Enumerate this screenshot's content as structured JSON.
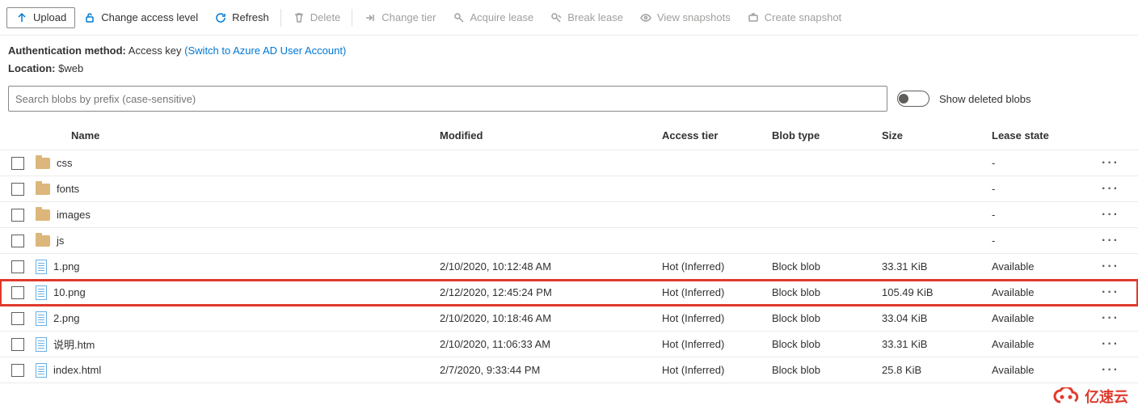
{
  "toolbar": {
    "upload": "Upload",
    "access_level": "Change access level",
    "refresh": "Refresh",
    "delete": "Delete",
    "change_tier": "Change tier",
    "acquire_lease": "Acquire lease",
    "break_lease": "Break lease",
    "view_snapshots": "View snapshots",
    "create_snapshot": "Create snapshot"
  },
  "info": {
    "auth_label": "Authentication method:",
    "auth_value": "Access key",
    "auth_link": "(Switch to Azure AD User Account)",
    "location_label": "Location:",
    "location_value": "$web"
  },
  "search": {
    "placeholder": "Search blobs by prefix (case-sensitive)"
  },
  "toggle_label": "Show deleted blobs",
  "columns": {
    "name": "Name",
    "modified": "Modified",
    "access_tier": "Access tier",
    "blob_type": "Blob type",
    "size": "Size",
    "lease_state": "Lease state"
  },
  "rows": [
    {
      "type": "folder",
      "name": "css",
      "modified": "",
      "tier": "",
      "blob": "",
      "size": "",
      "lease": "-"
    },
    {
      "type": "folder",
      "name": "fonts",
      "modified": "",
      "tier": "",
      "blob": "",
      "size": "",
      "lease": "-"
    },
    {
      "type": "folder",
      "name": "images",
      "modified": "",
      "tier": "",
      "blob": "",
      "size": "",
      "lease": "-"
    },
    {
      "type": "folder",
      "name": "js",
      "modified": "",
      "tier": "",
      "blob": "",
      "size": "",
      "lease": "-"
    },
    {
      "type": "file",
      "name": "1.png",
      "modified": "2/10/2020, 10:12:48 AM",
      "tier": "Hot (Inferred)",
      "blob": "Block blob",
      "size": "33.31 KiB",
      "lease": "Available"
    },
    {
      "type": "file",
      "name": "10.png",
      "modified": "2/12/2020, 12:45:24 PM",
      "tier": "Hot (Inferred)",
      "blob": "Block blob",
      "size": "105.49 KiB",
      "lease": "Available",
      "highlight": true
    },
    {
      "type": "file",
      "name": "2.png",
      "modified": "2/10/2020, 10:18:46 AM",
      "tier": "Hot (Inferred)",
      "blob": "Block blob",
      "size": "33.04 KiB",
      "lease": "Available"
    },
    {
      "type": "file",
      "name": "说明.htm",
      "modified": "2/10/2020, 11:06:33 AM",
      "tier": "Hot (Inferred)",
      "blob": "Block blob",
      "size": "33.31 KiB",
      "lease": "Available"
    },
    {
      "type": "file",
      "name": "index.html",
      "modified": "2/7/2020, 9:33:44 PM",
      "tier": "Hot (Inferred)",
      "blob": "Block blob",
      "size": "25.8 KiB",
      "lease": "Available"
    }
  ],
  "watermark": "亿速云"
}
